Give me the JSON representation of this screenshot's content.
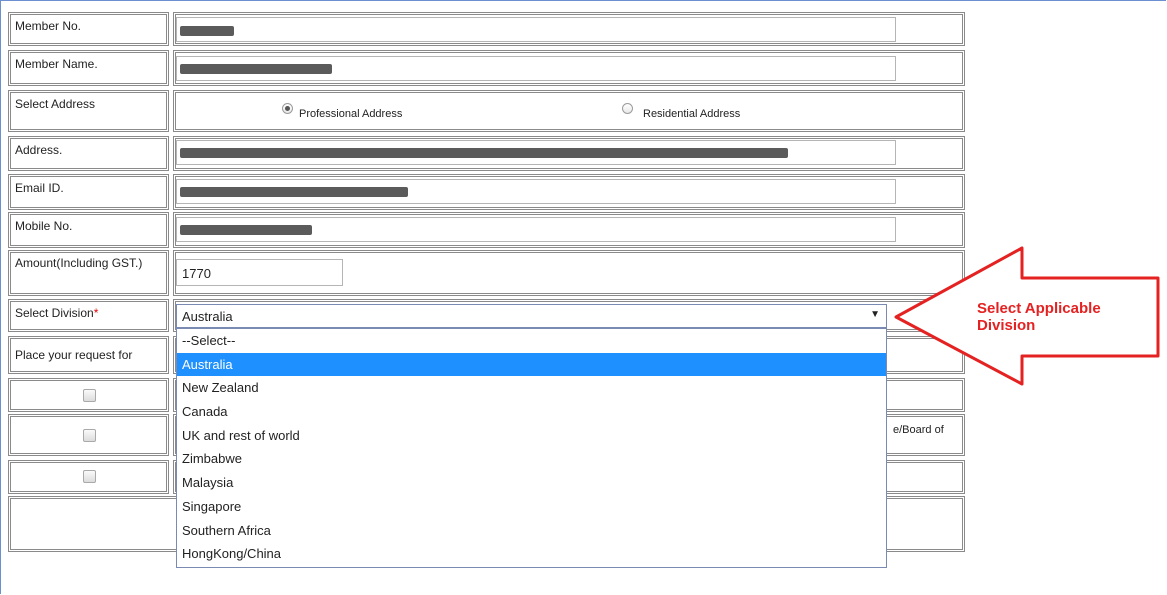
{
  "form": {
    "member_no_label": "Member No.",
    "member_name_label": "Member Name.",
    "select_address_label": "Select Address",
    "address_options": [
      "Professional Address",
      "Residential Address"
    ],
    "address_label": "Address.",
    "email_label": "Email ID.",
    "mobile_label": "Mobile No.",
    "amount_label": "Amount(Including GST.)",
    "amount_value": "1770",
    "division_label": "Select Division",
    "division_required_mark": "*",
    "division_selected": "Australia",
    "request_label": "Place your request for",
    "row3_partial_text": "e/Board of"
  },
  "dropdown": {
    "options": [
      "--Select--",
      "Australia",
      "New Zealand",
      "Canada",
      "UK and rest of world",
      "Zimbabwe",
      "Malaysia",
      "Singapore",
      "Southern Africa",
      "HongKong/China"
    ],
    "highlighted": "Australia"
  },
  "annotation": {
    "line1": "Select Applicable",
    "line2": "Division",
    "color": "#e52222"
  },
  "colors": {
    "highlight": "#1e90ff",
    "required": "#e00000"
  },
  "icons": {
    "select_caret": "▼"
  }
}
